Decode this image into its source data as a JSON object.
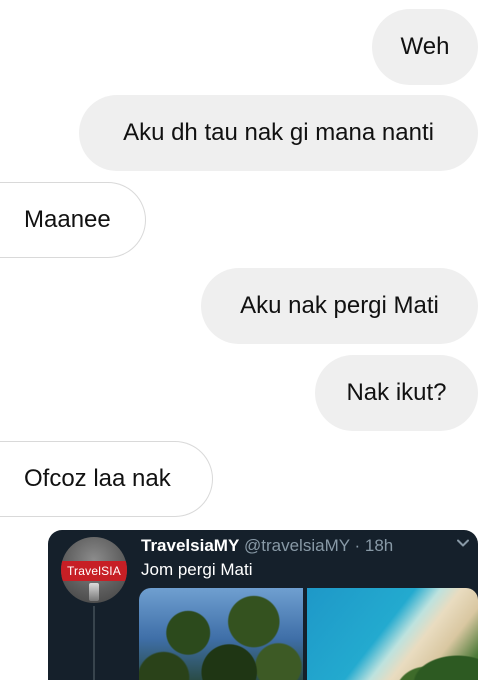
{
  "messages": [
    {
      "side": "sent",
      "text": "Weh"
    },
    {
      "side": "sent",
      "text": "Aku dh tau nak gi mana nanti"
    },
    {
      "side": "received",
      "text": "Maanee"
    },
    {
      "side": "sent",
      "text": "Aku nak pergi Mati"
    },
    {
      "side": "sent",
      "text": "Nak ikut?"
    },
    {
      "side": "received",
      "text": "Ofcoz laa nak"
    }
  ],
  "tweet": {
    "avatar_text": "TravelSIA",
    "display_name": "TravelsiaMY",
    "meta": " @travelsiaMY · 18h",
    "text": "Jom pergi Mati",
    "menu_icon": "chevron-down-icon",
    "media": [
      "tree-canopy-photo",
      "beach-aerial-photo"
    ]
  },
  "colors": {
    "sent_bubble": "#efefef",
    "received_border": "#d9d9d9",
    "tweet_bg": "#15202b",
    "tweet_meta": "#8899a6",
    "avatar_band": "#c71f25"
  }
}
